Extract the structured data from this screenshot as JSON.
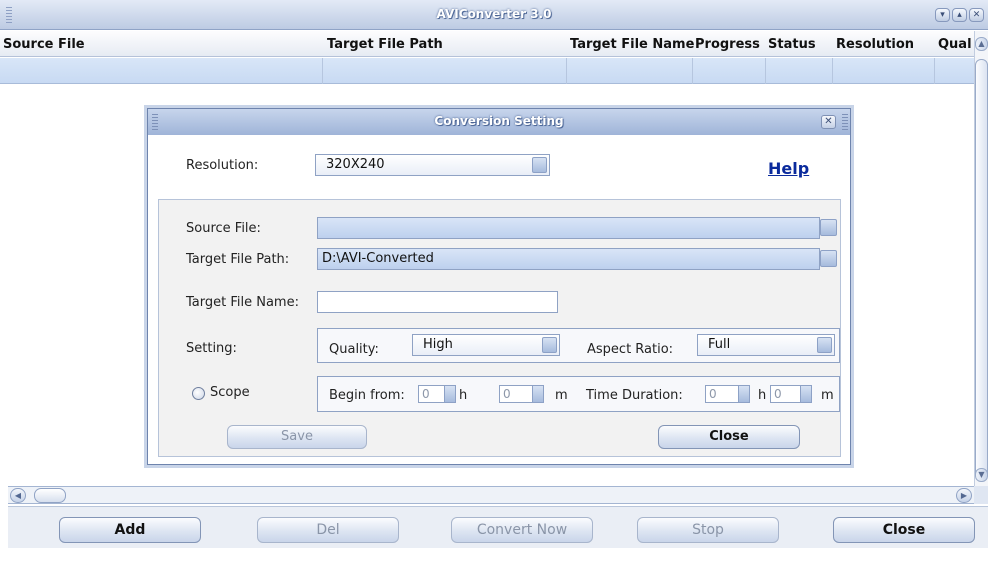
{
  "window": {
    "title": "AVIConverter 3.0"
  },
  "table": {
    "columns": [
      "Source File",
      "Target File Path",
      "Target File Name",
      "Progress",
      "Status",
      "Resolution",
      "Qual"
    ]
  },
  "toolbar": {
    "add_label": "Add",
    "del_label": "Del",
    "convert_label": "Convert Now",
    "stop_label": "Stop",
    "close_label": "Close"
  },
  "dialog": {
    "title": "Conversion Setting",
    "resolution_label": "Resolution:",
    "resolution_value": "320X240",
    "help_label": "Help",
    "source_file_label": "Source File:",
    "source_file_value": "",
    "target_path_label": "Target File Path:",
    "target_path_value": "D:\\AVI-Converted",
    "target_name_label": "Target File Name:",
    "target_name_value": "",
    "setting_label": "Setting:",
    "quality_label": "Quality:",
    "quality_value": "High",
    "aspect_label": "Aspect Ratio:",
    "aspect_value": "Full",
    "scope_label": "Scope",
    "begin_label": "Begin from:",
    "begin_h": "0",
    "h_unit": "h",
    "begin_m": "0",
    "m_unit": "m",
    "duration_label": "Time Duration:",
    "duration_h": "0",
    "duration_m": "0",
    "save_label": "Save",
    "close_label": "Close"
  }
}
